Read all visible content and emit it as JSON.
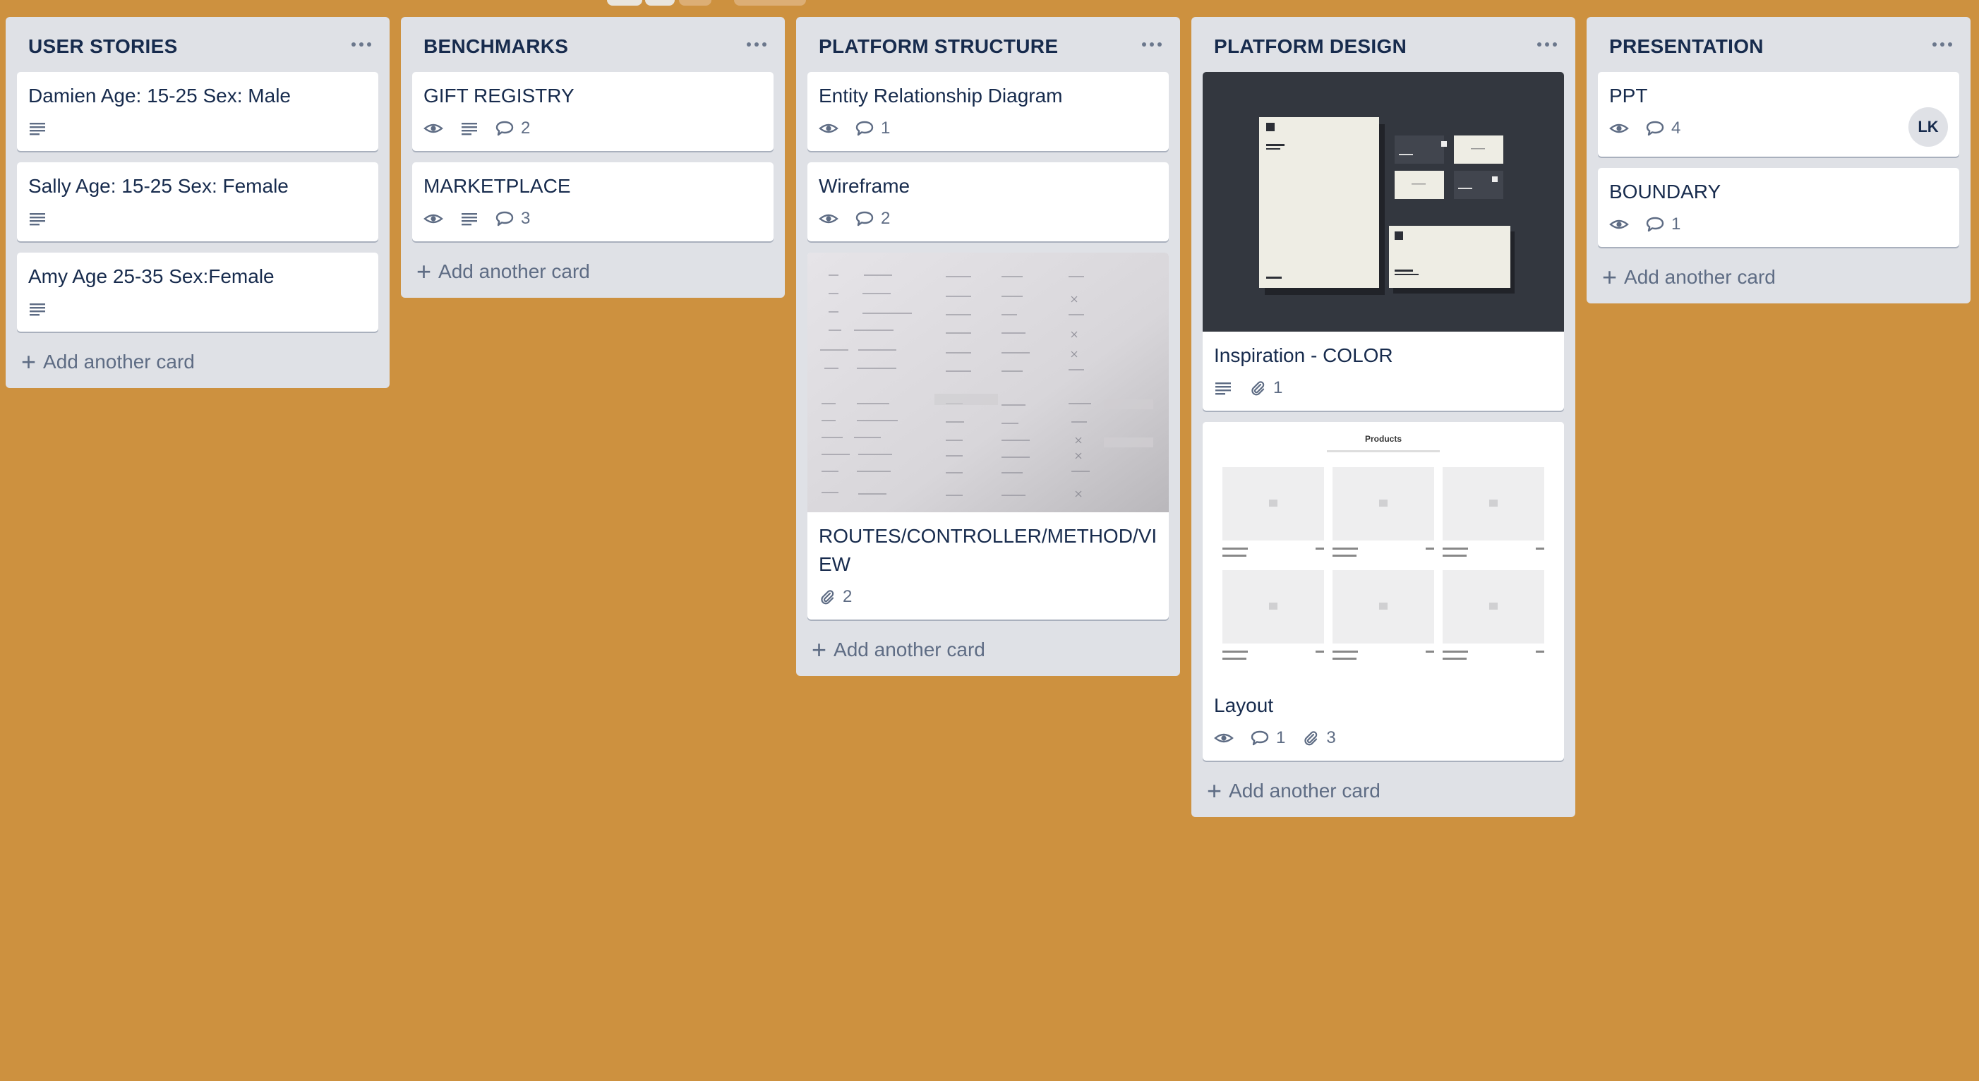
{
  "colors": {
    "board_background": "#cd913f",
    "list_background": "#dfe1e6",
    "text_primary": "#172b4d",
    "text_muted": "#5e6c84"
  },
  "board": {
    "lists": [
      {
        "title": "USER STORIES",
        "cards": [
          {
            "title": "Damien Age: 15-25 Sex: Male",
            "badges": [
              "description-icon"
            ]
          },
          {
            "title": "Sally Age: 15-25 Sex: Female",
            "badges": [
              "description-icon"
            ]
          },
          {
            "title": "Amy Age 25-35 Sex:Female",
            "badges": [
              "description-icon"
            ]
          }
        ],
        "add_card_label": "Add another card"
      },
      {
        "title": "BENCHMARKS",
        "cards": [
          {
            "title": "GIFT REGISTRY",
            "badges": [
              "watch-icon",
              "description-icon",
              "comment-icon"
            ],
            "comments": "2"
          },
          {
            "title": "MARKETPLACE",
            "badges": [
              "watch-icon",
              "description-icon",
              "comment-icon"
            ],
            "comments": "3"
          }
        ],
        "add_card_label": "Add another card"
      },
      {
        "title": "PLATFORM STRUCTURE",
        "cards": [
          {
            "title": "Entity Relationship Diagram",
            "badges": [
              "watch-icon",
              "comment-icon"
            ],
            "comments": "1"
          },
          {
            "title": "Wireframe",
            "badges": [
              "watch-icon",
              "comment-icon"
            ],
            "comments": "2"
          },
          {
            "title": "ROUTES/CONTROLLER/METHOD/VIEW",
            "cover": "handwritten-routes-photo",
            "badges": [
              "attachment-icon"
            ],
            "attachments": "2"
          }
        ],
        "add_card_label": "Add another card"
      },
      {
        "title": "PLATFORM DESIGN",
        "cards": [
          {
            "title": "Inspiration - COLOR",
            "cover": "stationery-mockup-image",
            "badges": [
              "description-icon",
              "attachment-icon"
            ],
            "attachments": "1"
          },
          {
            "title": "Layout",
            "cover": "product-grid-wireframe",
            "cover_heading": "Products",
            "badges": [
              "watch-icon",
              "comment-icon",
              "attachment-icon"
            ],
            "comments": "1",
            "attachments": "3"
          }
        ],
        "add_card_label": "Add another card"
      },
      {
        "title": "PRESENTATION",
        "cards": [
          {
            "title": "PPT",
            "badges": [
              "watch-icon",
              "comment-icon"
            ],
            "comments": "4",
            "member_initials": "LK"
          },
          {
            "title": "BOUNDARY",
            "badges": [
              "watch-icon",
              "comment-icon"
            ],
            "comments": "1"
          }
        ],
        "add_card_label": "Add another card"
      }
    ]
  }
}
